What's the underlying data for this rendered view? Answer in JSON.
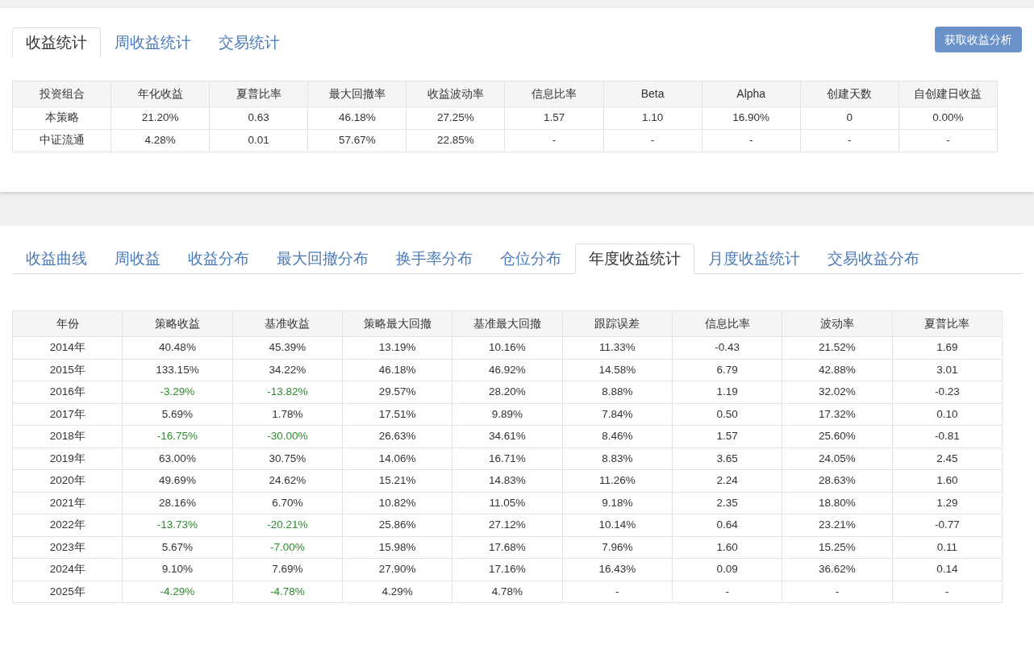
{
  "top_tabs": [
    {
      "label": "收益统计",
      "selected": true
    },
    {
      "label": "周收益统计",
      "selected": false
    },
    {
      "label": "交易统计",
      "selected": false
    }
  ],
  "action_button": "获取收益分析",
  "summary_table": {
    "columns": [
      "投资组合",
      "年化收益",
      "夏普比率",
      "最大回撤率",
      "收益波动率",
      "信息比率",
      "Beta",
      "Alpha",
      "创建天数",
      "自创建日收益"
    ],
    "rows": [
      [
        "本策略",
        "21.20%",
        "0.63",
        "46.18%",
        "27.25%",
        "1.57",
        "1.10",
        "16.90%",
        "0",
        "0.00%"
      ],
      [
        "中证流通",
        "4.28%",
        "0.01",
        "57.67%",
        "22.85%",
        "-",
        "-",
        "-",
        "-",
        "-"
      ]
    ]
  },
  "chart_tabs": [
    {
      "label": "收益曲线",
      "selected": false
    },
    {
      "label": "周收益",
      "selected": false
    },
    {
      "label": "收益分布",
      "selected": false
    },
    {
      "label": "最大回撤分布",
      "selected": false
    },
    {
      "label": "换手率分布",
      "selected": false
    },
    {
      "label": "仓位分布",
      "selected": false
    },
    {
      "label": "年度收益统计",
      "selected": true
    },
    {
      "label": "月度收益统计",
      "selected": false
    },
    {
      "label": "交易收益分布",
      "selected": false
    }
  ],
  "yearly_table": {
    "columns": [
      "年份",
      "策略收益",
      "基准收益",
      "策略最大回撤",
      "基准最大回撤",
      "跟踪误差",
      "信息比率",
      "波动率",
      "夏普比率"
    ],
    "rows": [
      [
        "2014年",
        "40.48%",
        "45.39%",
        "13.19%",
        "10.16%",
        "11.33%",
        "-0.43",
        "21.52%",
        "1.69"
      ],
      [
        "2015年",
        "133.15%",
        "34.22%",
        "46.18%",
        "46.92%",
        "14.58%",
        "6.79",
        "42.88%",
        "3.01"
      ],
      [
        "2016年",
        {
          "text": "-3.29%",
          "negative": true
        },
        {
          "text": "-13.82%",
          "negative": true
        },
        "29.57%",
        "28.20%",
        "8.88%",
        "1.19",
        "32.02%",
        "-0.23"
      ],
      [
        "2017年",
        "5.69%",
        "1.78%",
        "17.51%",
        "9.89%",
        "7.84%",
        "0.50",
        "17.32%",
        "0.10"
      ],
      [
        "2018年",
        {
          "text": "-16.75%",
          "negative": true
        },
        {
          "text": "-30.00%",
          "negative": true
        },
        "26.63%",
        "34.61%",
        "8.46%",
        "1.57",
        "25.60%",
        "-0.81"
      ],
      [
        "2019年",
        "63.00%",
        "30.75%",
        "14.06%",
        "16.71%",
        "8.83%",
        "3.65",
        "24.05%",
        "2.45"
      ],
      [
        "2020年",
        "49.69%",
        "24.62%",
        "15.21%",
        "14.83%",
        "11.26%",
        "2.24",
        "28.63%",
        "1.60"
      ],
      [
        "2021年",
        "28.16%",
        "6.70%",
        "10.82%",
        "11.05%",
        "9.18%",
        "2.35",
        "18.80%",
        "1.29"
      ],
      [
        "2022年",
        {
          "text": "-13.73%",
          "negative": true
        },
        {
          "text": "-20.21%",
          "negative": true
        },
        "25.86%",
        "27.12%",
        "10.14%",
        "0.64",
        "23.21%",
        "-0.77"
      ],
      [
        "2023年",
        "5.67%",
        {
          "text": "-7.00%",
          "negative": true
        },
        "15.98%",
        "17.68%",
        "7.96%",
        "1.60",
        "15.25%",
        "0.11"
      ],
      [
        "2024年",
        "9.10%",
        "7.69%",
        "27.90%",
        "17.16%",
        "16.43%",
        "0.09",
        "36.62%",
        "0.14"
      ],
      [
        "2025年",
        {
          "text": "-4.29%",
          "negative": true
        },
        {
          "text": "-4.78%",
          "negative": true
        },
        "4.29%",
        "4.78%",
        "-",
        "-",
        "-",
        "-"
      ]
    ]
  }
}
